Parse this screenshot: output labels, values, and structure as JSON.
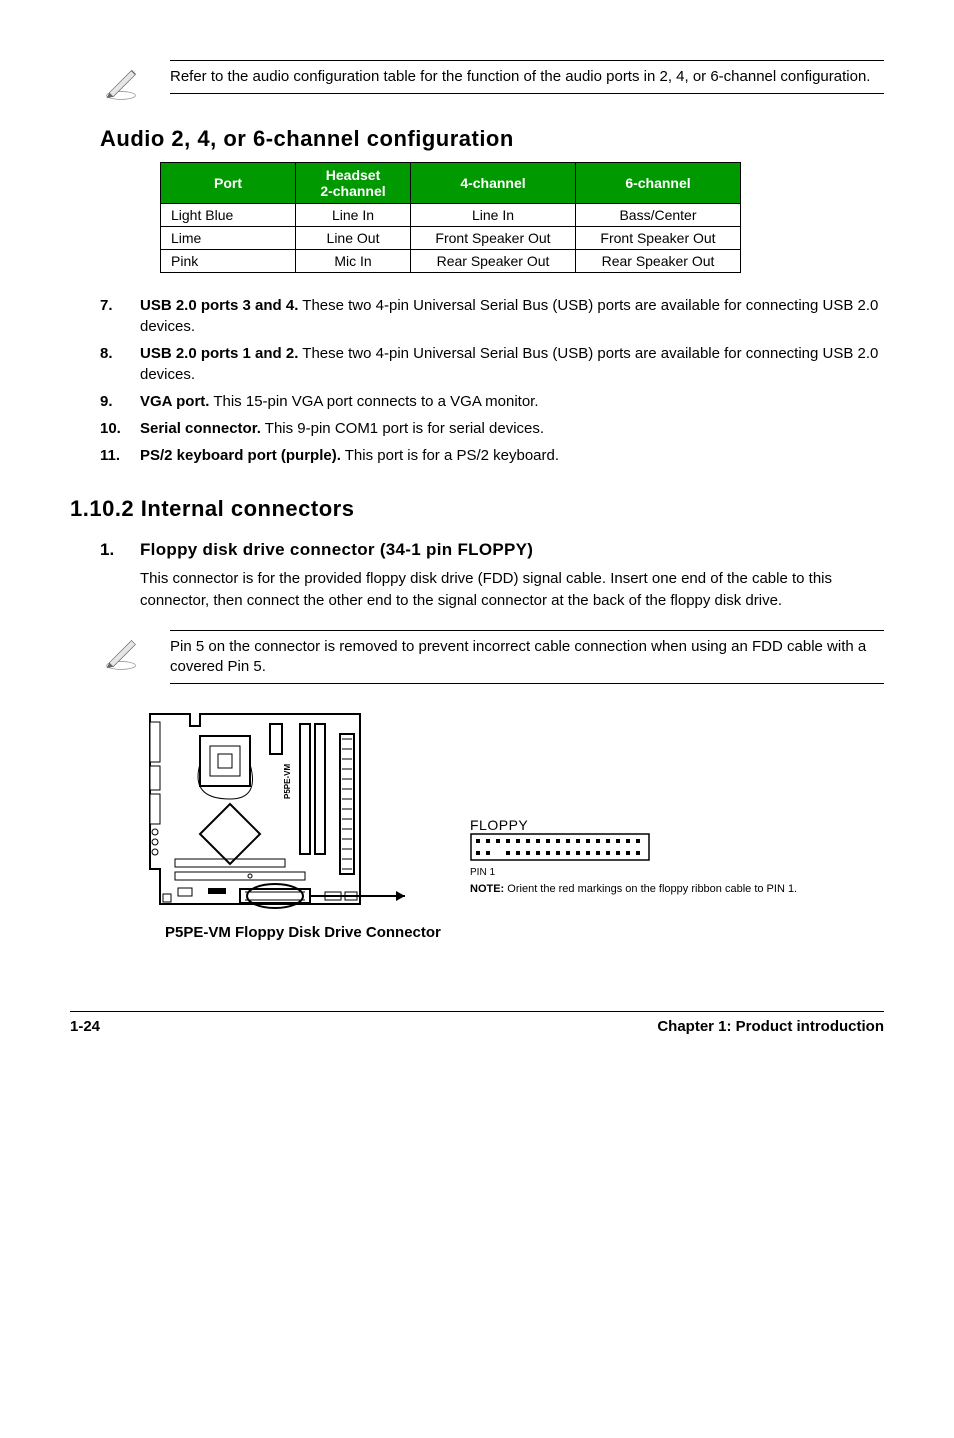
{
  "top_note": "Refer to the audio configuration table for the function of the audio ports in 2, 4, or 6-channel configuration.",
  "audio_section_title": "Audio 2, 4, or 6-channel configuration",
  "audio_table": {
    "headers": {
      "port": "Port",
      "hs": "Headset\n2-channel",
      "c4": "4-channel",
      "c6": "6-channel"
    },
    "rows": [
      {
        "port": "Light Blue",
        "hs": "Line In",
        "c4": "Line In",
        "c6": "Bass/Center"
      },
      {
        "port": "Lime",
        "hs": "Line Out",
        "c4": "Front Speaker Out",
        "c6": "Front Speaker Out"
      },
      {
        "port": "Pink",
        "hs": "Mic In",
        "c4": "Rear Speaker Out",
        "c6": "Rear Speaker Out"
      }
    ]
  },
  "features": [
    {
      "num": "7.",
      "bold": "USB 2.0 ports 3 and 4.",
      "rest": " These two 4-pin Universal Serial Bus (USB) ports are available for connecting USB 2.0 devices."
    },
    {
      "num": "8.",
      "bold": "USB 2.0 ports 1 and 2.",
      "rest": " These two 4-pin Universal Serial Bus (USB) ports are available for connecting USB 2.0 devices."
    },
    {
      "num": "9.",
      "bold": "VGA port.",
      "rest": " This 15-pin VGA port connects to a VGA monitor."
    },
    {
      "num": "10.",
      "bold": "Serial connector.",
      "rest": " This 9-pin COM1 port is for serial devices."
    },
    {
      "num": "11.",
      "bold": "PS/2 keyboard port (purple).",
      "rest": " This port is for a PS/2 keyboard."
    }
  ],
  "internal_title": "1.10.2 Internal connectors",
  "floppy_item": {
    "num": "1.",
    "title": "Floppy disk drive connector (34-1 pin FLOPPY)"
  },
  "floppy_desc": "This connector is for the provided floppy disk drive (FDD) signal cable. Insert one end of the cable to this connector, then connect the other end to the signal connector at the back of the floppy disk drive.",
  "floppy_note": "Pin 5 on the connector is removed to prevent incorrect cable connection when using an FDD cable with a covered Pin 5.",
  "diagram": {
    "board_label": "P5PE-VM",
    "conn_label": "FLOPPY",
    "pin_label": "PIN 1",
    "note_bold": "NOTE:",
    "note_rest": " Orient the red markings on the floppy ribbon cable to PIN 1.",
    "caption": "P5PE-VM Floppy Disk Drive Connector"
  },
  "chart_data": {
    "type": "table",
    "title": "Audio 2, 4, or 6-channel configuration",
    "columns": [
      "Port",
      "Headset 2-channel",
      "4-channel",
      "6-channel"
    ],
    "rows": [
      [
        "Light Blue",
        "Line In",
        "Line In",
        "Bass/Center"
      ],
      [
        "Lime",
        "Line Out",
        "Front Speaker Out",
        "Front Speaker Out"
      ],
      [
        "Pink",
        "Mic In",
        "Rear Speaker Out",
        "Rear Speaker Out"
      ]
    ]
  },
  "footer": {
    "left": "1-24",
    "right": "Chapter 1: Product introduction"
  }
}
